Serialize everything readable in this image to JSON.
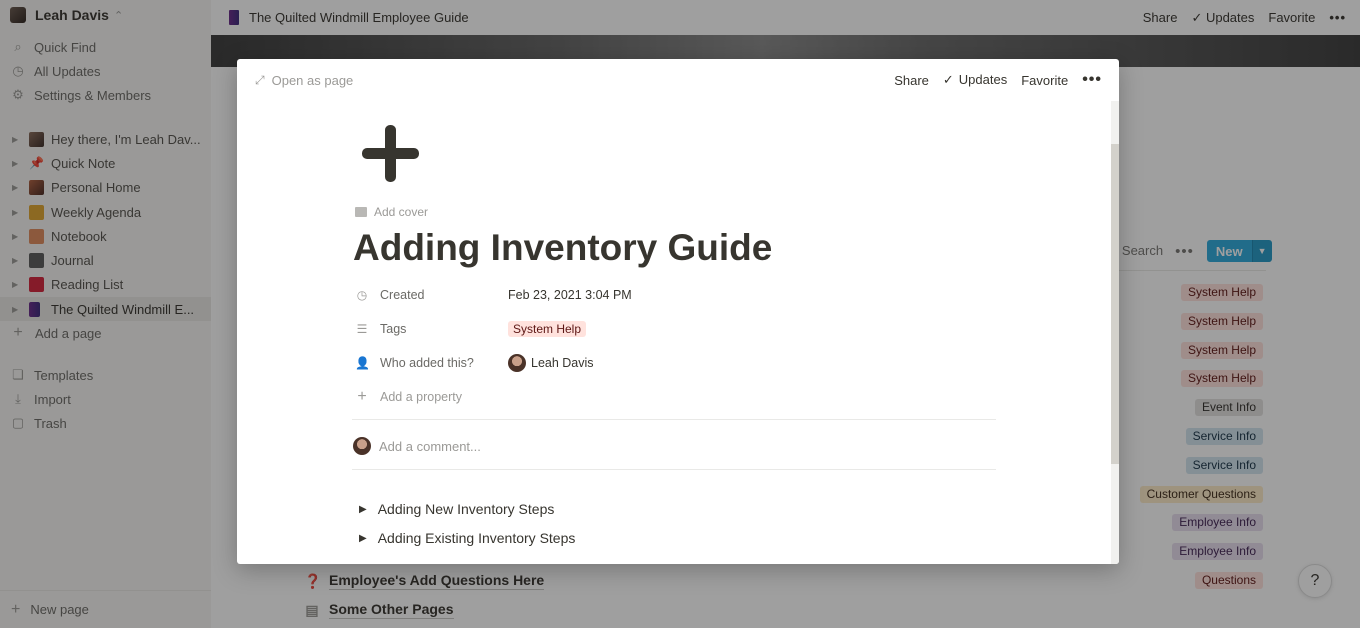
{
  "sidebar": {
    "workspace": "Leah Davis",
    "nav": [
      {
        "icon": "search-icon",
        "glyph": "⌕",
        "label": "Quick Find"
      },
      {
        "icon": "clock-icon",
        "glyph": "◷",
        "label": "All Updates"
      },
      {
        "icon": "gear-icon",
        "glyph": "⚙",
        "label": "Settings & Members"
      }
    ],
    "pages": [
      {
        "label": "Hey there, I'm Leah Dav...",
        "icon": "photo-icon"
      },
      {
        "label": "Quick Note",
        "icon": "pushpin-icon"
      },
      {
        "label": "Personal Home",
        "icon": "photo-icon"
      },
      {
        "label": "Weekly Agenda",
        "icon": "notebook-icon"
      },
      {
        "label": "Notebook",
        "icon": "notebook-icon"
      },
      {
        "label": "Journal",
        "icon": "journal-icon"
      },
      {
        "label": "Reading List",
        "icon": "book-icon"
      },
      {
        "label": "The Quilted Windmill E...",
        "icon": "book-icon"
      }
    ],
    "add_page": "Add a page",
    "tools": [
      {
        "icon": "templates-icon",
        "glyph": "❏",
        "label": "Templates"
      },
      {
        "icon": "import-icon",
        "glyph": "⤓",
        "label": "Import"
      },
      {
        "icon": "trash-icon",
        "glyph": "🗑",
        "label": "Trash"
      }
    ],
    "new_page": "New page"
  },
  "topbar": {
    "title": "The Quilted Windmill Employee Guide",
    "share": "Share",
    "updates": "Updates",
    "favorite": "Favorite"
  },
  "database": {
    "search": "Search",
    "new": "New",
    "tags": [
      {
        "label": "System Help",
        "color": "red"
      },
      {
        "label": "System Help",
        "color": "red"
      },
      {
        "label": "System Help",
        "color": "red"
      },
      {
        "label": "System Help",
        "color": "red"
      },
      {
        "label": "Event Info",
        "color": "gray"
      },
      {
        "label": "Service Info",
        "color": "blue"
      },
      {
        "label": "Service Info",
        "color": "blue"
      },
      {
        "label": "Customer Questions",
        "color": "yellow"
      },
      {
        "label": "Employee Info",
        "color": "purple"
      },
      {
        "label": "Employee Info",
        "color": "purple"
      },
      {
        "label": "Questions",
        "color": "red"
      }
    ],
    "rows": [
      {
        "icon": "question-icon",
        "label": "Employee's Add Questions Here"
      },
      {
        "icon": "page-icon",
        "label": "Some Other Pages"
      }
    ]
  },
  "modal": {
    "open_as_page": "Open as page",
    "share": "Share",
    "updates": "Updates",
    "favorite": "Favorite",
    "add_cover": "Add cover",
    "title": "Adding Inventory Guide",
    "properties": [
      {
        "icon": "clock-icon",
        "name": "Created",
        "value": "Feb 23, 2021 3:04 PM"
      },
      {
        "icon": "list-icon",
        "name": "Tags",
        "value": "System Help"
      },
      {
        "icon": "person-icon",
        "name": "Who added this?",
        "value": "Leah Davis"
      }
    ],
    "add_property": "Add a property",
    "comment_placeholder": "Add a comment...",
    "toggles": [
      "Adding New Inventory Steps",
      "Adding Existing Inventory Steps"
    ]
  },
  "help": "?"
}
